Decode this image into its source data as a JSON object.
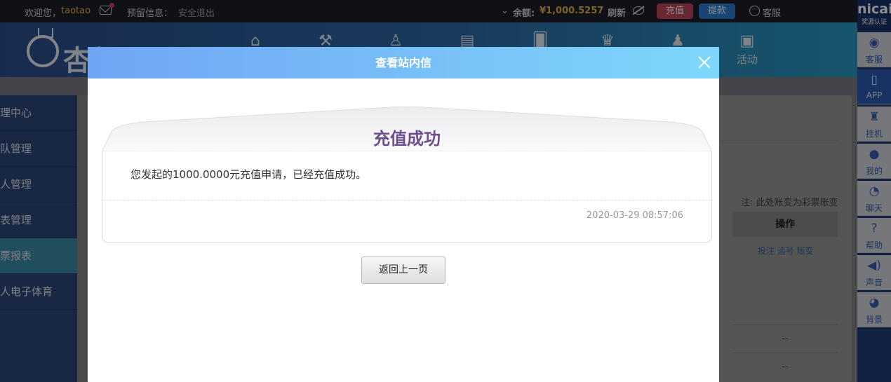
{
  "topbar": {
    "welcome": "欢迎您，",
    "username": "taotao",
    "reserve_label": "预留信息：",
    "logout": "安全退出",
    "balance_label": "余额:",
    "balance_value": "¥1,000.5257",
    "refresh": "刷新",
    "recharge": "充值",
    "withdraw": "提款",
    "service": "客服"
  },
  "nav": {
    "logo_text": "杏耀",
    "items": [
      {
        "icon": "home-icon",
        "label": ""
      },
      {
        "icon": "hammer-icon",
        "label": ""
      },
      {
        "icon": "user-icon",
        "label": ""
      },
      {
        "icon": "slot-icon",
        "label": ""
      },
      {
        "icon": "cards-icon",
        "label": ""
      },
      {
        "icon": "trophy-icon",
        "label": ""
      },
      {
        "icon": "people-icon",
        "label": ""
      },
      {
        "icon": "gift-icon",
        "label": "活动"
      }
    ]
  },
  "sidebar": {
    "items": [
      {
        "label": "理中心"
      },
      {
        "label": "队管理"
      },
      {
        "label": "人管理"
      },
      {
        "label": "表管理"
      },
      {
        "label": "票报表"
      },
      {
        "label": "人电子体育"
      }
    ]
  },
  "background": {
    "note": "注: 此处账变为彩票账变",
    "col_header": "操作",
    "row_links": "投注 追号 账变",
    "dash1": "--",
    "dash2": "--"
  },
  "rightbar": {
    "top_big": "nicai",
    "top_small": "奖源认证",
    "items": [
      {
        "label": "客服"
      },
      {
        "label": "APP"
      },
      {
        "label": "挂机"
      },
      {
        "label": "我的"
      },
      {
        "label": "聊天"
      },
      {
        "label": "帮助"
      },
      {
        "label": "声音"
      },
      {
        "label": "背景"
      }
    ]
  },
  "modal": {
    "title": "查看站内信",
    "letter_title": "充值成功",
    "letter_text": "您发起的1000.0000元充值申请，已经充值成功。",
    "letter_date": "2020-03-29 08:57:06",
    "back_button": "返回上一页"
  },
  "colors": {
    "header_gradient_start": "#6fa5f4",
    "header_gradient_end": "#7ed7fb",
    "letter_title": "#6e4d8d",
    "recharge_btn": "#c0475a",
    "withdraw_btn": "#2f7fd1",
    "balance": "#e7b34a"
  }
}
